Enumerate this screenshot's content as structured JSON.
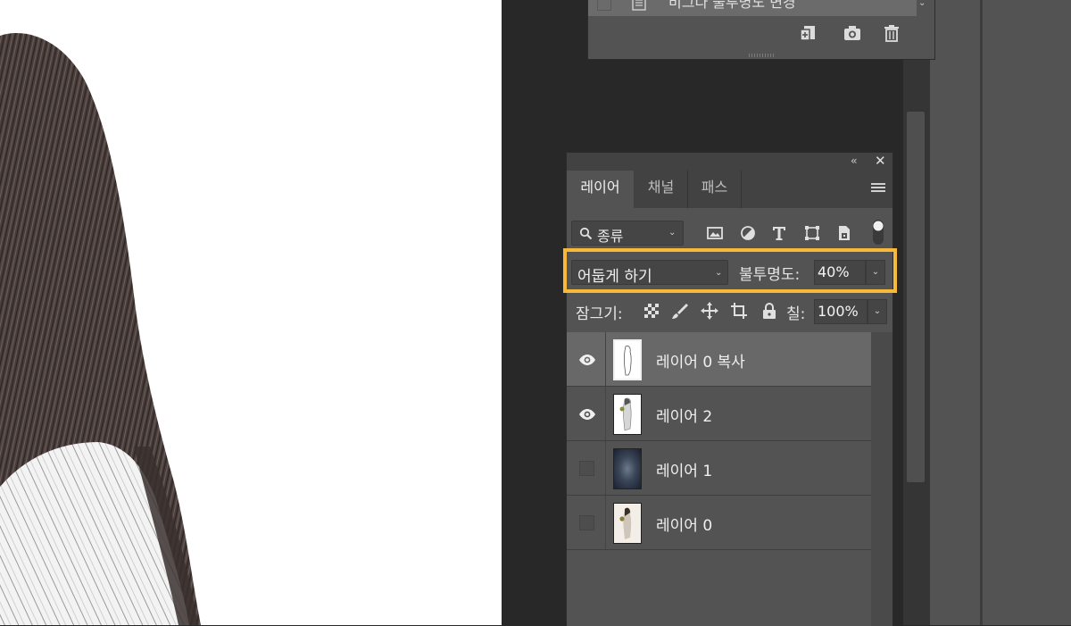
{
  "history_panel": {
    "row_text": "비그다 불투명도 변경"
  },
  "layers_panel": {
    "tabs": [
      {
        "label": "레이어",
        "active": true
      },
      {
        "label": "채널",
        "active": false
      },
      {
        "label": "패스",
        "active": false
      }
    ],
    "filter": {
      "label": "종류"
    },
    "blend_mode": "어둡게 하기",
    "opacity_label": "불투명도:",
    "opacity_value": "40%",
    "lock_label": "잠그기:",
    "fill_label": "칠:",
    "fill_value": "100%",
    "layers": [
      {
        "name": "레이어 0 복사",
        "visible": true,
        "selected": true
      },
      {
        "name": "레이어 2",
        "visible": true,
        "selected": false
      },
      {
        "name": "레이어 1",
        "visible": false,
        "selected": false
      },
      {
        "name": "레이어 0",
        "visible": false,
        "selected": false
      }
    ]
  },
  "colors": {
    "highlight": "#f8b938",
    "panel_bg": "#535353",
    "workspace_bg": "#282828"
  }
}
